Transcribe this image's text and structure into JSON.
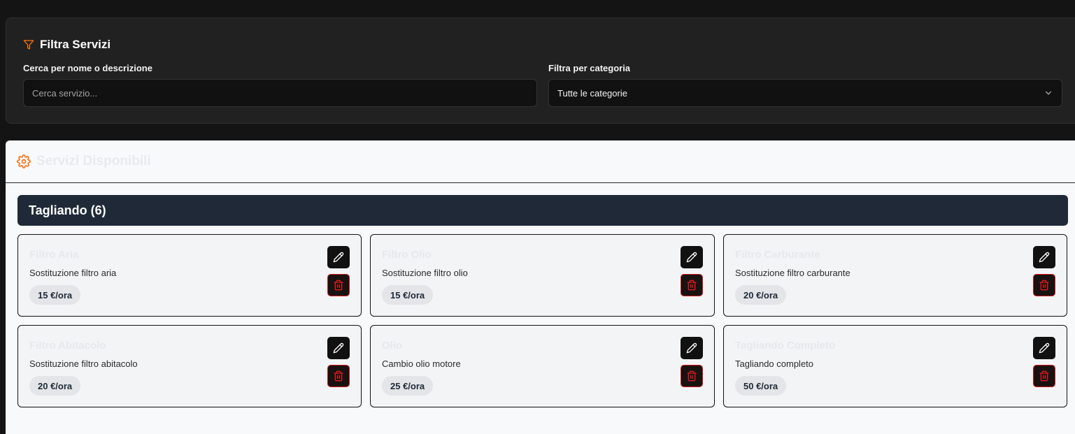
{
  "filter": {
    "title": "Filtra Servizi",
    "search_label": "Cerca per nome o descrizione",
    "search_placeholder": "Cerca servizio...",
    "search_value": "",
    "category_label": "Filtra per categoria",
    "category_selected": "Tutte le categorie"
  },
  "services": {
    "title": "Servizi Disponibili",
    "category": {
      "label": "Tagliando (6)",
      "items": [
        {
          "name": "Filtro Aria",
          "description": "Sostituzione filtro aria",
          "price": "15 €/ora"
        },
        {
          "name": "Filtro Olio",
          "description": "Sostituzione filtro olio",
          "price": "15 €/ora"
        },
        {
          "name": "Filtro Carburante",
          "description": "Sostituzione filtro carburante",
          "price": "20 €/ora"
        },
        {
          "name": "Filtro Abitacolo",
          "description": "Sostituzione filtro abitacolo",
          "price": "20 €/ora"
        },
        {
          "name": "Olio",
          "description": "Cambio olio motore",
          "price": "25 €/ora"
        },
        {
          "name": "Tagliando Completo",
          "description": "Tagliando completo",
          "price": "50 €/ora"
        }
      ]
    }
  },
  "icons": {
    "filter": "filter-icon",
    "settings": "gear-icon",
    "edit": "pencil-icon",
    "delete": "trash-icon",
    "dropdown": "chevron-down-icon"
  },
  "colors": {
    "accent": "#f97316",
    "danger": "#d11a1a",
    "category_bar": "#1f2937"
  }
}
